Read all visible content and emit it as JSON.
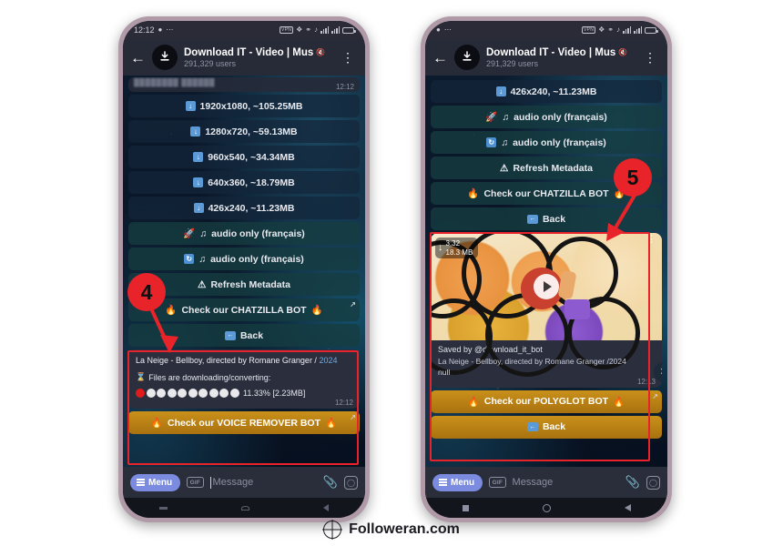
{
  "status_bar": {
    "time": "12:12",
    "icons": [
      "dnd-icon",
      "more-icon",
      "vpn-icon",
      "bluetooth-icon",
      "link-icon",
      "mute-icon",
      "signal-icon",
      "signal-5g-icon",
      "battery-icon"
    ],
    "vpn_label": "VPN",
    "network_label": "5G"
  },
  "header": {
    "back_icon": "back-arrow-icon",
    "avatar_icon": "download-avatar-icon",
    "title": "Download IT - Video | Mus",
    "mute_icon": "muted-speaker-icon",
    "subtitle": "291,329 users",
    "menu_icon": "overflow-menu-icon"
  },
  "left_phone": {
    "partial_message": {
      "blurred_text": "████████  ██████",
      "timestamp": "12:12"
    },
    "quality_buttons": [
      {
        "icon": "download-icon",
        "label": "1920x1080, ~105.25MB"
      },
      {
        "icon": "download-icon",
        "label": "1280x720, ~59.13MB"
      },
      {
        "icon": "download-icon",
        "label": "960x540, ~34.34MB"
      },
      {
        "icon": "download-icon",
        "label": "640x360, ~18.79MB"
      },
      {
        "icon": "download-icon",
        "label": "426x240, ~11.23MB"
      }
    ],
    "audio_buttons": [
      {
        "icon": "rocket-icon",
        "icon2": "music-note-icon",
        "label": "audio only (français)"
      },
      {
        "icon": "sync-icon",
        "icon2": "music-note-icon",
        "label": "audio only (français)"
      }
    ],
    "action_buttons": [
      {
        "icon": "warning-icon",
        "label": "Refresh Metadata"
      },
      {
        "icon": "fire-icon",
        "label": "Check our CHATZILLA BOT"
      },
      {
        "icon": "back-arrow-box-icon",
        "label": "Back"
      }
    ],
    "progress_message": {
      "title": "La Neige - Bellboy, directed by Romane Granger /",
      "year": "2024",
      "status_icon": "hourglass-icon",
      "status_text": "Files are downloading/converting:",
      "progress_percent": "11.33%",
      "progress_size": "[2.23MB]",
      "progress_label": "11.33% [2.23MB]",
      "dots_total": 10,
      "dots_filled": 1,
      "timestamp": "12:12"
    },
    "promo_button": {
      "icon": "fire-icon",
      "label": "Check our VOICE REMOVER BOT"
    }
  },
  "right_phone": {
    "quality_buttons": [
      {
        "icon": "download-icon",
        "label": "426x240, ~11.23MB"
      }
    ],
    "audio_buttons": [
      {
        "icon": "rocket-icon",
        "icon2": "music-note-icon",
        "label": "audio only (français)"
      },
      {
        "icon": "sync-icon",
        "icon2": "music-note-icon",
        "label": "audio only (français)"
      }
    ],
    "action_buttons": [
      {
        "icon": "warning-icon",
        "label": "Refresh Metadata"
      },
      {
        "icon": "fire-icon",
        "label": "Check our CHATZILLA BOT"
      },
      {
        "icon": "back-arrow-box-icon",
        "label": "Back"
      }
    ],
    "video_message": {
      "download_icon": "download-arrow-icon",
      "duration": "3:32",
      "size": "18.3 MB",
      "play_icon": "play-icon",
      "overflow_icon": "overflow-menu-icon",
      "saved_by": "Saved by @download_it_bot",
      "caption": "La Neige - Bellboy, directed by Romane Granger /2024",
      "caption_extra": "null",
      "timestamp": "12:13",
      "share_icon": "share-icon"
    },
    "promo_button": {
      "icon": "fire-icon",
      "label": "Check our POLYGLOT BOT"
    },
    "back_button": {
      "icon": "back-arrow-box-icon",
      "label": "Back"
    }
  },
  "input_bar": {
    "menu_label": "Menu",
    "menu_icon": "hamburger-icon",
    "gif_label": "GIF",
    "placeholder": "Message",
    "attach_icon": "paperclip-icon",
    "camera_icon": "camera-icon"
  },
  "nav_bar": {
    "recent_icon": "square-icon",
    "home_icon": "circle-icon",
    "back_icon": "triangle-back-icon"
  },
  "annotations": [
    {
      "number": "4",
      "target": "download-progress-message"
    },
    {
      "number": "5",
      "target": "saved-video-message"
    }
  ],
  "footer": {
    "icon": "globe-icon",
    "text": "Followeran.com"
  },
  "colors": {
    "accent_red": "#e8242a",
    "gold_button": "#c9901a",
    "menu_blue": "#7b8ce0",
    "progress_red": "#e01b1b"
  }
}
